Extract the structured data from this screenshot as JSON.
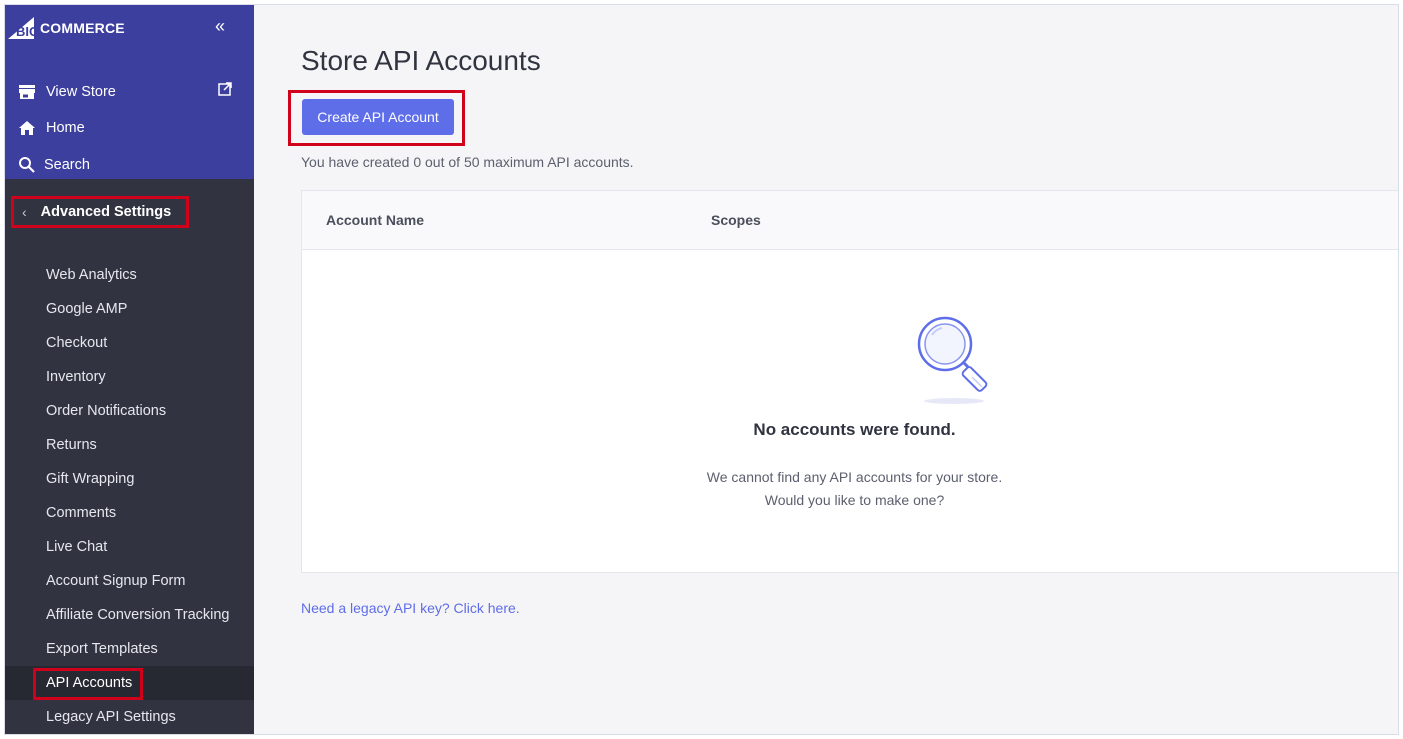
{
  "app": {
    "brand": "BIGCOMMERCE",
    "brand_prefix": "BIG",
    "brand_suffix": "COMMERCE"
  },
  "sidebar": {
    "top_items": [
      {
        "label": "View Store",
        "icon": "storefront-icon"
      },
      {
        "label": "Home",
        "icon": "home-icon"
      },
      {
        "label": "Search",
        "icon": "search-icon"
      }
    ],
    "section_title": "Advanced Settings",
    "items": [
      {
        "label": "Web Analytics"
      },
      {
        "label": "Google AMP"
      },
      {
        "label": "Checkout"
      },
      {
        "label": "Inventory"
      },
      {
        "label": "Order Notifications"
      },
      {
        "label": "Returns"
      },
      {
        "label": "Gift Wrapping"
      },
      {
        "label": "Comments"
      },
      {
        "label": "Live Chat"
      },
      {
        "label": "Account Signup Form"
      },
      {
        "label": "Affiliate Conversion Tracking"
      },
      {
        "label": "Export Templates"
      },
      {
        "label": "API Accounts",
        "active": true
      },
      {
        "label": "Legacy API Settings"
      }
    ]
  },
  "main": {
    "title": "Store API Accounts",
    "create_button": "Create API Account",
    "info_text": "You have created 0 out of 50 maximum API accounts.",
    "table": {
      "columns": [
        "Account Name",
        "Scopes"
      ]
    },
    "empty": {
      "title": "No accounts were found.",
      "line1": "We cannot find any API accounts for your store.",
      "line2": "Would you like to make one?"
    },
    "legacy_link": "Need a legacy API key? Click here."
  },
  "colors": {
    "sidebar_top": "#3c3f9e",
    "sidebar_bg": "#313440",
    "accent": "#5e6de8",
    "highlight": "#d0021b"
  }
}
